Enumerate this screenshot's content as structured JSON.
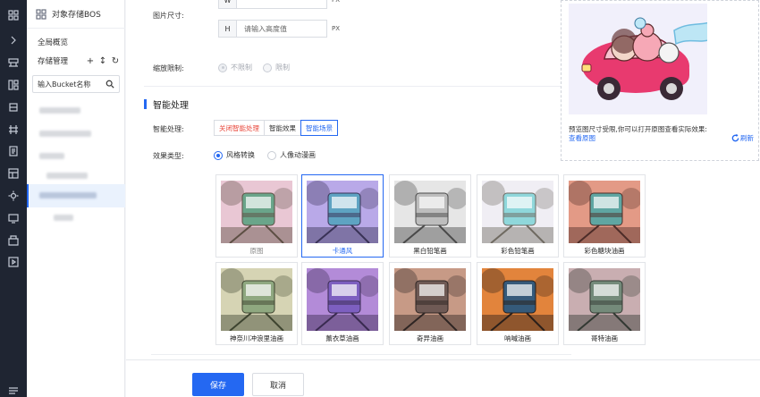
{
  "sidebar": {
    "title": "对象存储BOS",
    "overview": "全局概览",
    "storage": "存储管理",
    "search_placeholder": "输入Bucket名称"
  },
  "form": {
    "size_label": "图片尺寸:",
    "height_prefix": "H",
    "height_placeholder": "请输入高度值",
    "unit": "PX",
    "zoom_label": "缩放限制:",
    "zoom_options": [
      "不限制",
      "限制"
    ],
    "section_title": "智能处理",
    "smart_label": "智能处理:",
    "smart_buttons": [
      "关闭智能处理",
      "智能效果",
      "智能场景"
    ],
    "effect_type_label": "效果类型:",
    "effect_type_options": [
      "风格转换",
      "人像动漫画"
    ]
  },
  "effects": [
    {
      "label": "原图",
      "colors": [
        "#e9c7d4",
        "#6aa58a",
        "#5e4f44"
      ]
    },
    {
      "label": "卡通风",
      "colors": [
        "#b9a9e8",
        "#5ea3c2",
        "#3a3256"
      ]
    },
    {
      "label": "黑白铅笔画",
      "colors": [
        "#e6e6e6",
        "#bdbdbd",
        "#4a4a4a"
      ]
    },
    {
      "label": "彩色铅笔画",
      "colors": [
        "#f0eef4",
        "#8fd7db",
        "#6f6a62"
      ]
    },
    {
      "label": "彩色糖块油画",
      "colors": [
        "#e39a86",
        "#5fa6a2",
        "#4d2d28"
      ]
    },
    {
      "label": "神奈川冲浪里油画",
      "colors": [
        "#d6d4b4",
        "#8fa880",
        "#3f4430"
      ]
    },
    {
      "label": "薰衣草油画",
      "colors": [
        "#b38bd8",
        "#7d5fc0",
        "#3a2b50"
      ]
    },
    {
      "label": "奇异油画",
      "colors": [
        "#c79a86",
        "#6f5a55",
        "#2f2624"
      ]
    },
    {
      "label": "呐喊油画",
      "colors": [
        "#e2843c",
        "#355a7a",
        "#2a1f1a"
      ]
    },
    {
      "label": "哥特油画",
      "colors": [
        "#c9aeb1",
        "#748a7a",
        "#333a33"
      ]
    }
  ],
  "preview": {
    "tip": "预览图尺寸受限,你可以打开原图查看实际效果:",
    "view_original": "查看原图",
    "refresh": "刷新"
  },
  "footer": {
    "save": "保存",
    "cancel": "取消"
  }
}
